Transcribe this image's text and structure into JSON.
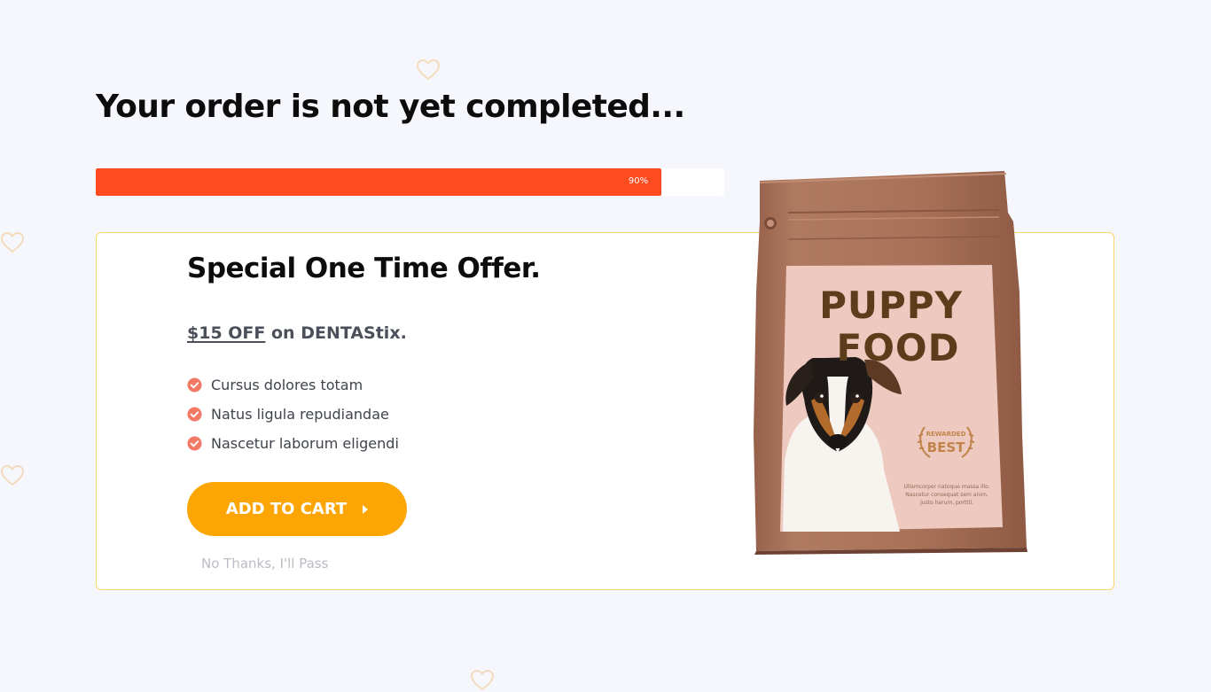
{
  "page": {
    "title": "Your order is not yet completed..."
  },
  "progress": {
    "value": 0.9,
    "label": "90%",
    "fill_color": "#ff4b1f",
    "track_color": "#ffffff"
  },
  "offer": {
    "title": "Special One Time Offer.",
    "discount_amount": "$15 OFF",
    "discount_rest": " on DENTAStix.",
    "features": [
      {
        "label": "Cursus dolores totam",
        "icon": "check-circle-icon"
      },
      {
        "label": "Natus ligula repudiandae",
        "icon": "check-circle-icon"
      },
      {
        "label": "Nascetur laborum eligendi",
        "icon": "check-circle-icon"
      }
    ],
    "add_to_cart_label": "ADD TO CART",
    "decline_label": "No Thanks, I'll Pass",
    "border_color": "#f7d96b",
    "button_color": "#fca503",
    "check_color": "#f27a65"
  },
  "product": {
    "headline_line1": "PUPPY",
    "headline_line2": "FOOD",
    "badge_small": "REWARDED",
    "badge_big": "BEST",
    "caption": "Ullamcorper natoque massa illo. Nascetur consequat sem anim, justo harum, porttil.",
    "bag_color": "#a87158",
    "label_color": "#eec9bf"
  },
  "decorations": {
    "icon": "heart-outline-icon",
    "color": "#f3d7b2"
  }
}
